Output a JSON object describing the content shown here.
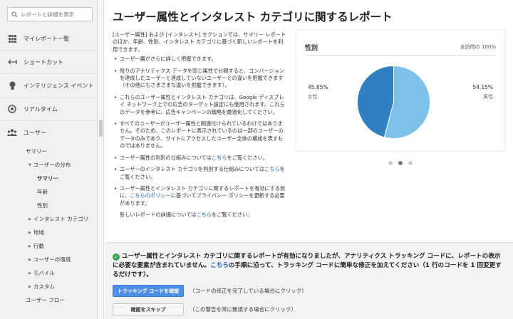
{
  "sidebar": {
    "search_placeholder": "レポートと詳細を表示",
    "items": [
      {
        "label": "マイレポート一覧",
        "icon": "grid-icon"
      },
      {
        "label": "ショートカット",
        "icon": "shortcut-arrow-icon"
      },
      {
        "label": "インテリジェンス イベント",
        "icon": "lightbulb-icon"
      },
      {
        "label": "リアルタイム",
        "icon": "realtime-clock-icon"
      },
      {
        "label": "ユーザー",
        "icon": "users-icon"
      }
    ],
    "sub": {
      "summary": "サマリー",
      "distribution": "ユーザーの分布",
      "dist_summary": "サマリー",
      "age": "年齢",
      "gender": "性別",
      "interest": "インタレスト カテゴリ",
      "region": "地域",
      "behavior": "行動",
      "environment": "ユーザーの環境",
      "mobile": "モバイル",
      "custom": "カスタム",
      "userflow": "ユーザー フロー"
    }
  },
  "main": {
    "title": "ユーザー属性とインタレスト カテゴリに関するレポート",
    "intro": "[ユーザー属性] および [インタレスト] セクションでは、サマリー レポートのほか、年齢、性別、インタレスト カテゴリに基づく新しいレポートを利用できます。",
    "bullets": {
      "b1": "ユーザー層がさらに詳しく把握できます。",
      "b2": "残りのアナリティクス データを同じ属性で分類すると、コンバージョンを達成したユーザーと達成していないユーザーとの違いを把握できます（その他にもさまざまな違いを把握できます）。",
      "b3": "これらのユーザー属性とインタレスト カテゴリは、Google ディスプレイ ネットワーク上での広告のターゲット設定にも使用されます。これらのデータを参考に、広告キャンペーンの戦略を最適化してください。",
      "b4": "すべてのユーザーがユーザー属性と関連付けられているわけではありません。そのため、このレポートに表示されているのは一部のユーザーのデータのみであり、サイトにアクセスしたユーザー全体の構成を表すものではありません。",
      "b5_pre": "ユーザー属性の判別の仕組みについては",
      "b5_link": "こちら",
      "b5_post": "をご覧ください。",
      "b6_pre": "ユーザーのインタレスト カテゴリを判別する仕組みについては",
      "b6_link": "こちら",
      "b6_post": "をご覧ください。",
      "b7_pre": "ユーザー属性とインタレスト カテゴリに関するレポートを有効にする前に、",
      "b7_link": "こちらのポリシー",
      "b7_post": "に基づいてプライバシー ポリシーを更新する必要があります。"
    },
    "footer_pre": "新しいレポートの詳細については",
    "footer_link": "こちら",
    "footer_post": "をご覧ください。"
  },
  "card": {
    "title": "性別",
    "meta": "全訪問の 100%",
    "female_pct": "45.85%",
    "female_label": "女性",
    "male_pct": "54.15%",
    "male_label": "男性",
    "colors": {
      "female": "#2f7fc1",
      "male": "#7cc1e8"
    }
  },
  "chart_data": {
    "type": "pie",
    "title": "性別",
    "labels": [
      "女性",
      "男性"
    ],
    "values": [
      45.85,
      54.15
    ]
  },
  "carousel": {
    "count": 3,
    "active": 2
  },
  "notice": {
    "text_pre": "ユーザー属性とインタレスト カテゴリに関するレポートが有効になりましたが、アナリティクス トラッキング コードに、レポートの表示に必要な要素が含まれていません。",
    "link": "こちら",
    "text_post": "の手順に沿って、トラッキング コードに簡単な修正を加えてください（1 行のコードを 1 回変更するだけです）。",
    "btn_confirm": "トラッキング コードを確認",
    "btn_confirm_note": "（コードの修正を完了している場合にクリック）",
    "btn_skip": "確認をスキップ",
    "btn_skip_note": "（この警告を常に無視する場合にクリック）"
  }
}
